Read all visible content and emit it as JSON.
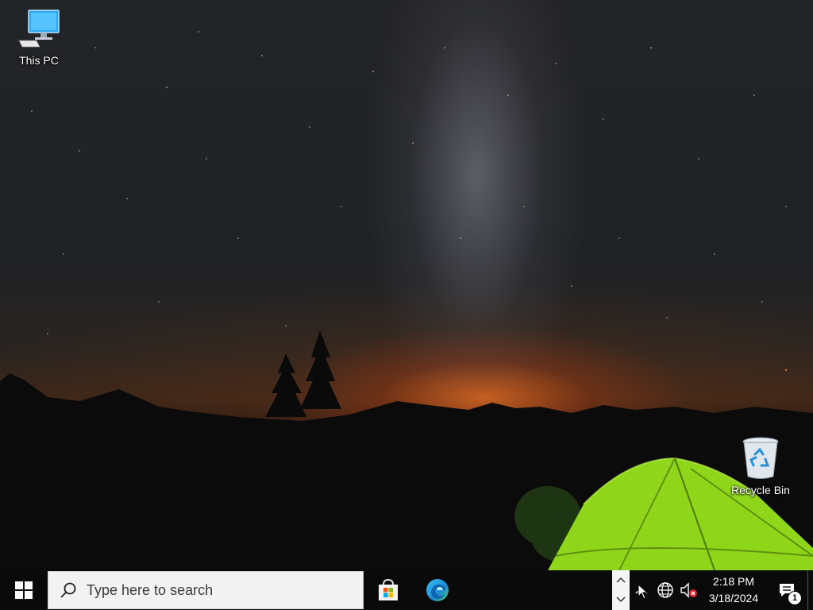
{
  "desktop": {
    "icons": [
      {
        "label": "This PC",
        "icon": "computer-icon"
      },
      {
        "label": "Recycle Bin",
        "icon": "recycle-bin-icon"
      }
    ]
  },
  "taskbar": {
    "start_icon": "windows-logo-icon",
    "search": {
      "placeholder": "Type here to search",
      "icon": "search-icon"
    },
    "pinned_apps": [
      {
        "name": "Microsoft Store",
        "icon": "microsoft-store-icon"
      },
      {
        "name": "Microsoft Edge",
        "icon": "edge-icon"
      }
    ],
    "tray": {
      "overflow_icon": "chevron-up-icon",
      "network_icon": "globe-icon",
      "volume_icon": "speaker-muted-icon",
      "time": "2:18 PM",
      "date": "3/18/2024",
      "notification_count": "1"
    }
  },
  "colors": {
    "taskbar_bg": "#0a0a0b",
    "search_bg": "#f2f2f2",
    "tent_green": "#8fd61a",
    "store_red": "#f25022",
    "store_green": "#7fba00",
    "store_blue": "#00a4ef",
    "store_yellow": "#ffb900"
  }
}
